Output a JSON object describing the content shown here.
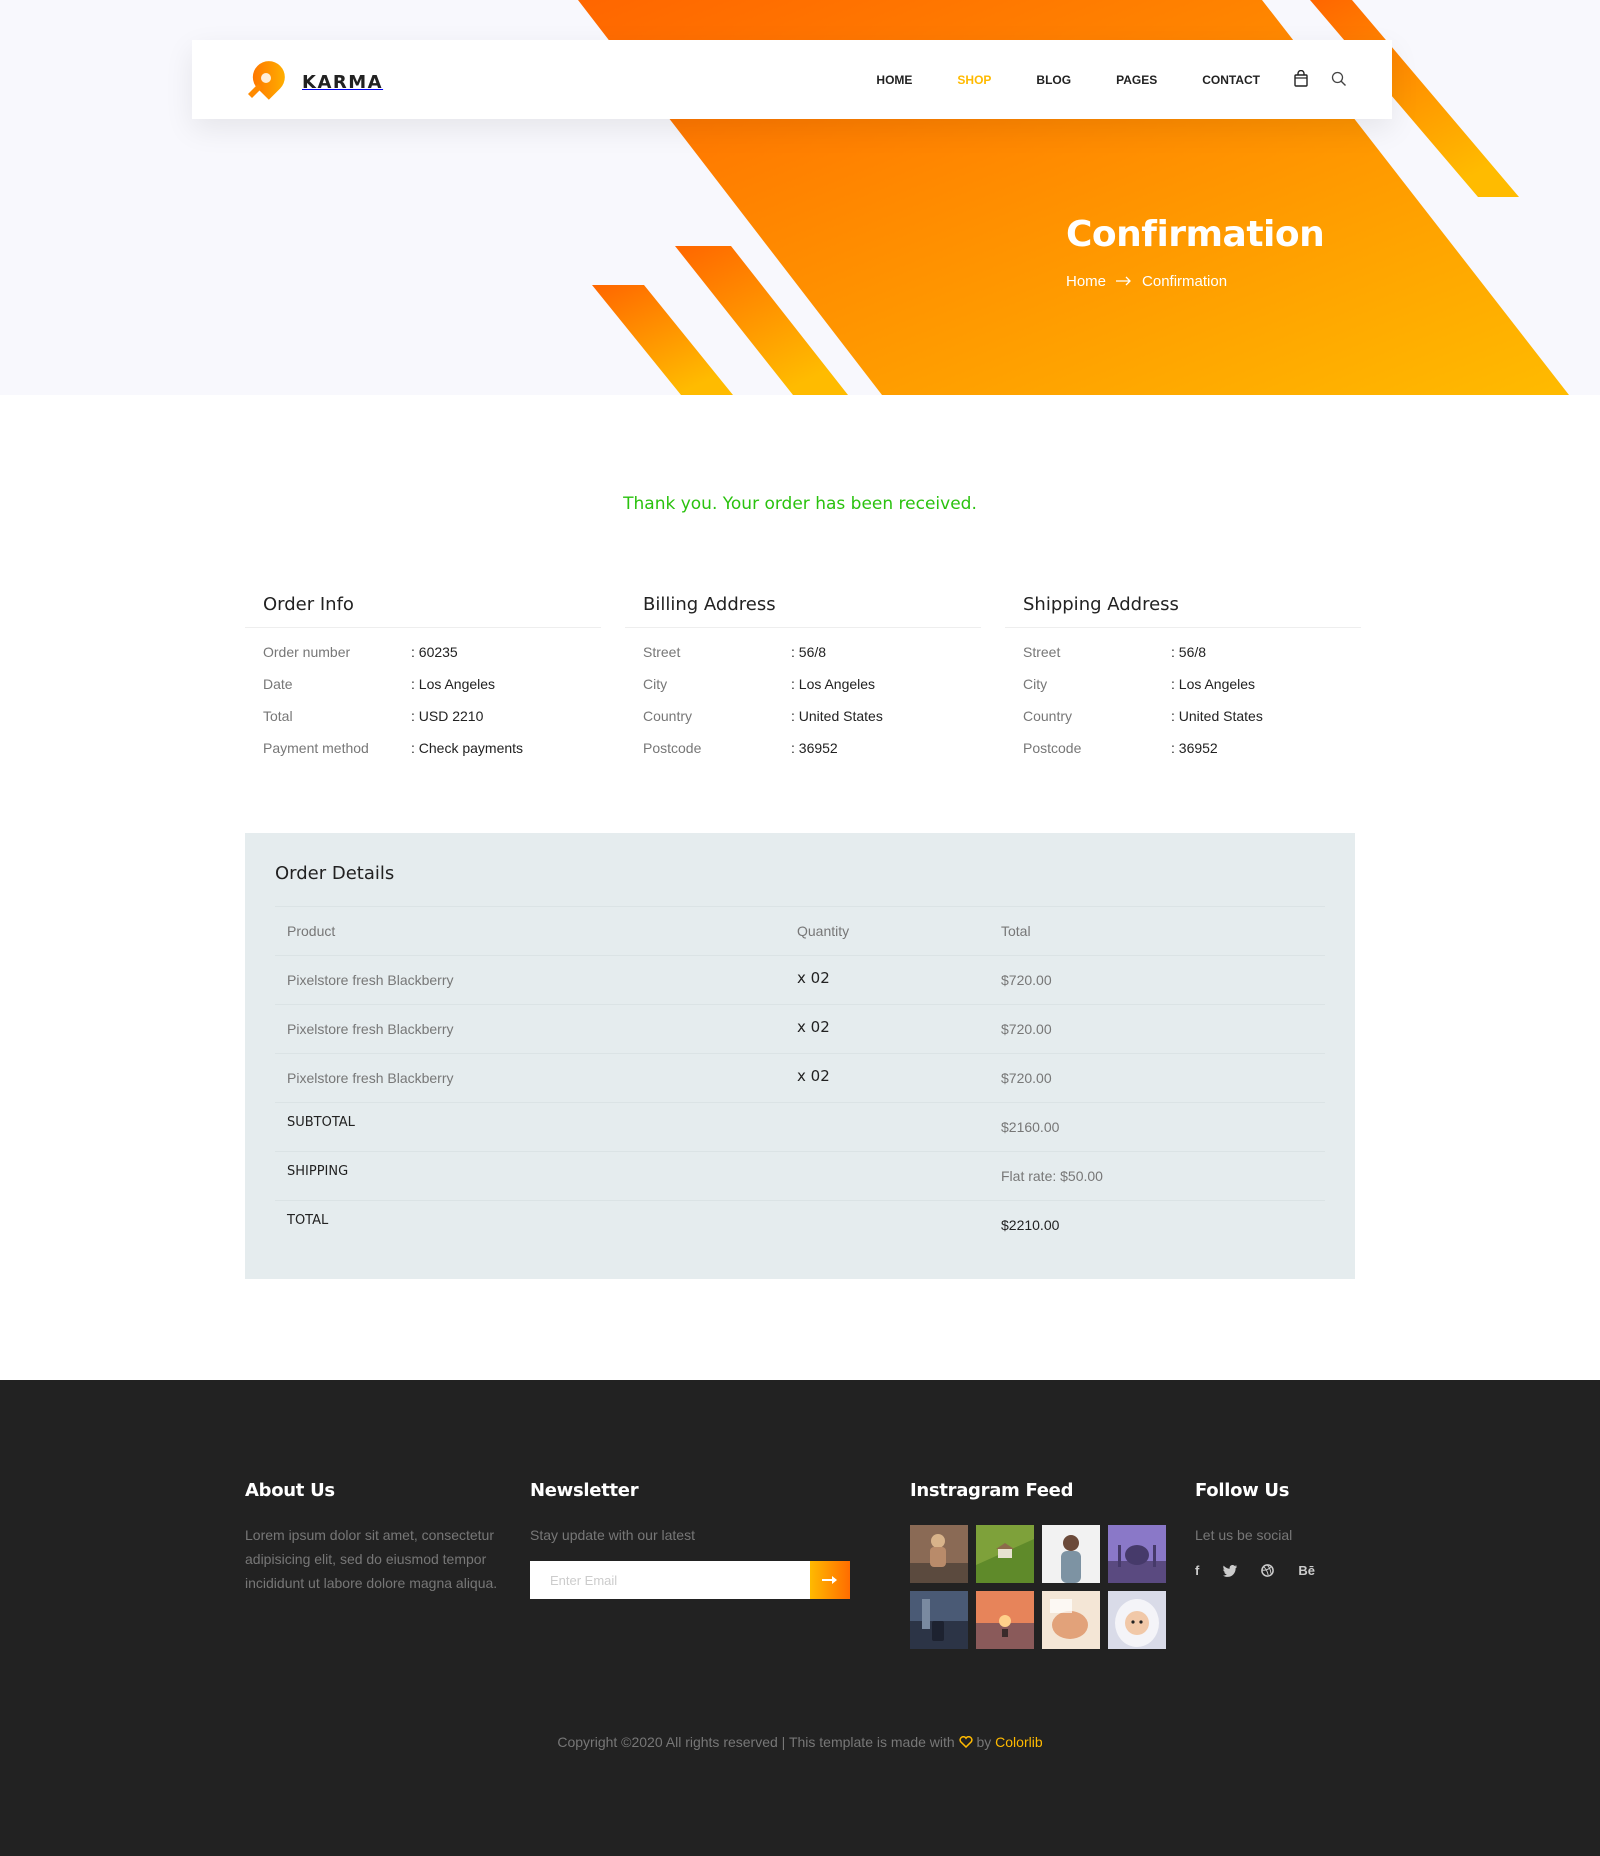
{
  "nav": {
    "brand": "KARMA",
    "items": [
      {
        "label": "HOME",
        "active": false
      },
      {
        "label": "SHOP",
        "active": true
      },
      {
        "label": "BLOG",
        "active": false
      },
      {
        "label": "PAGES",
        "active": false
      },
      {
        "label": "CONTACT",
        "active": false
      }
    ],
    "icons": [
      "shopping-bag-icon",
      "search-icon"
    ]
  },
  "banner": {
    "title": "Confirmation",
    "breadcrumb": [
      "Home",
      "Confirmation"
    ]
  },
  "thanks": "Thank you. Your order has been received.",
  "order_info": {
    "title": "Order Info",
    "rows": [
      {
        "label": "Order number",
        "value": ": 60235"
      },
      {
        "label": "Date",
        "value": ": Los Angeles"
      },
      {
        "label": "Total",
        "value": ": USD 2210"
      },
      {
        "label": "Payment method",
        "value": ": Check payments"
      }
    ]
  },
  "billing": {
    "title": "Billing Address",
    "rows": [
      {
        "label": "Street",
        "value": ": 56/8"
      },
      {
        "label": "City",
        "value": ": Los Angeles"
      },
      {
        "label": "Country",
        "value": ": United States"
      },
      {
        "label": "Postcode",
        "value": ": 36952"
      }
    ]
  },
  "shipping": {
    "title": "Shipping Address",
    "rows": [
      {
        "label": "Street",
        "value": ": 56/8"
      },
      {
        "label": "City",
        "value": ": Los Angeles"
      },
      {
        "label": "Country",
        "value": ": United States"
      },
      {
        "label": "Postcode",
        "value": ": 36952"
      }
    ]
  },
  "details": {
    "title": "Order Details",
    "headers": [
      "Product",
      "Quantity",
      "Total"
    ],
    "items": [
      {
        "product": "Pixelstore fresh Blackberry",
        "qty": "x 02",
        "total": "$720.00"
      },
      {
        "product": "Pixelstore fresh Blackberry",
        "qty": "x 02",
        "total": "$720.00"
      },
      {
        "product": "Pixelstore fresh Blackberry",
        "qty": "x 02",
        "total": "$720.00"
      }
    ],
    "subtotal": {
      "label": "SUBTOTAL",
      "value": "$2160.00"
    },
    "shipping": {
      "label": "SHIPPING",
      "value": "Flat rate: $50.00"
    },
    "total": {
      "label": "TOTAL",
      "value": "$2210.00"
    }
  },
  "footer": {
    "about": {
      "title": "About Us",
      "text": "Lorem ipsum dolor sit amet, consectetur adipisicing elit, sed do eiusmod tempor incididunt ut labore dolore magna aliqua."
    },
    "newsletter": {
      "title": "Newsletter",
      "text": "Stay update with our latest",
      "placeholder": "Enter Email"
    },
    "instagram": {
      "title": "Instragram Feed"
    },
    "follow": {
      "title": "Follow Us",
      "text": "Let us be social",
      "socials": [
        {
          "icon": "facebook-icon",
          "label": "f"
        },
        {
          "icon": "twitter-icon",
          "label": ""
        },
        {
          "icon": "dribbble-icon",
          "label": ""
        },
        {
          "icon": "behance-icon",
          "label": "Bē"
        }
      ]
    },
    "copyright": {
      "prefix": "Copyright ©2020 All rights reserved | This template is made with",
      "by": "by",
      "brand": "Colorlib"
    }
  },
  "colors": {
    "accent": "#ffba00",
    "accent_dark": "#ff6c00",
    "success": "#2ac20e",
    "footer_bg": "#222222"
  }
}
